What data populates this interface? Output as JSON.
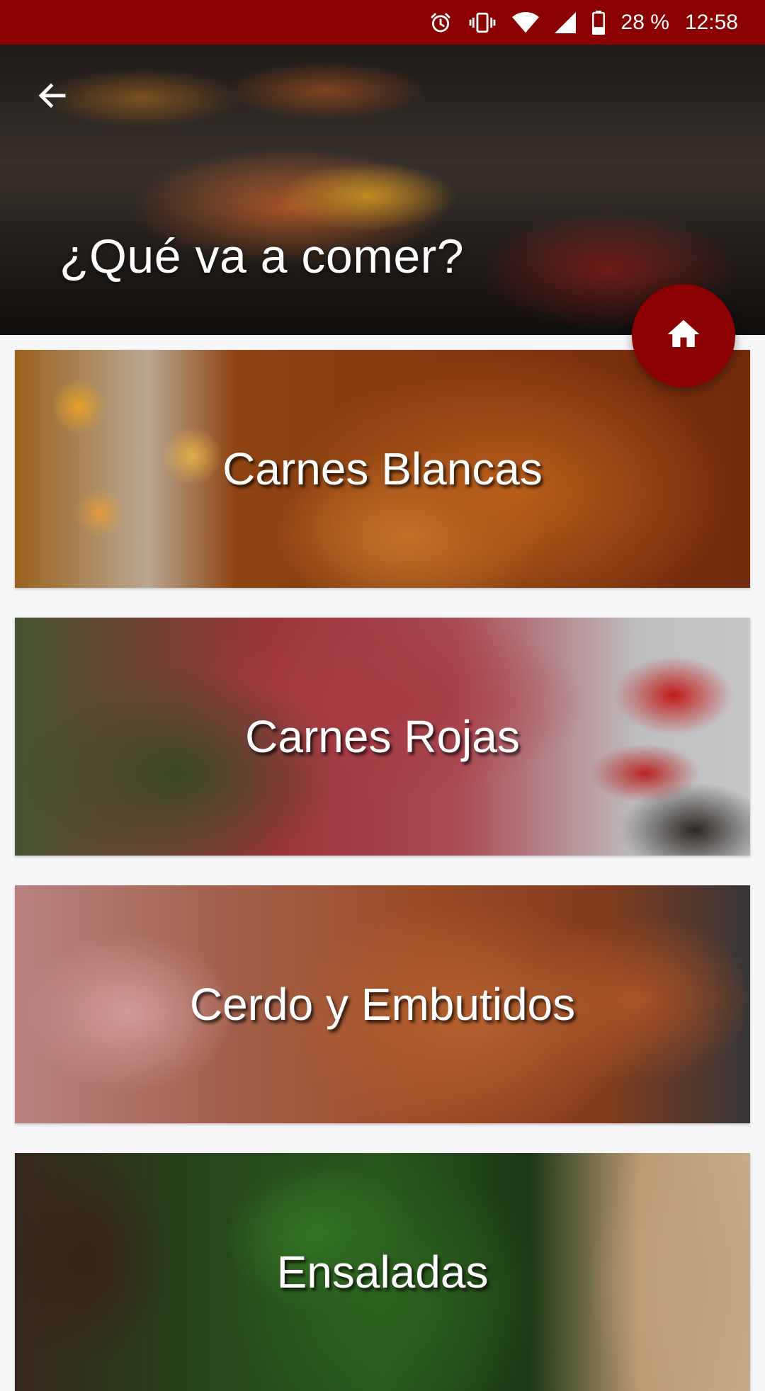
{
  "status_bar": {
    "icons": [
      "alarm-icon",
      "vibrate-icon",
      "wifi-icon",
      "signal-icon",
      "battery-icon"
    ],
    "battery": "28 %",
    "time": "12:58",
    "background": "#8b0000"
  },
  "header": {
    "title": "¿Qué va a comer?",
    "back_icon": "arrow-left-icon"
  },
  "fab": {
    "icon": "home-icon",
    "color": "#8b0000"
  },
  "categories": [
    {
      "label": "Carnes Blancas"
    },
    {
      "label": "Carnes Rojas"
    },
    {
      "label": "Cerdo y Embutidos"
    },
    {
      "label": "Ensaladas"
    }
  ]
}
